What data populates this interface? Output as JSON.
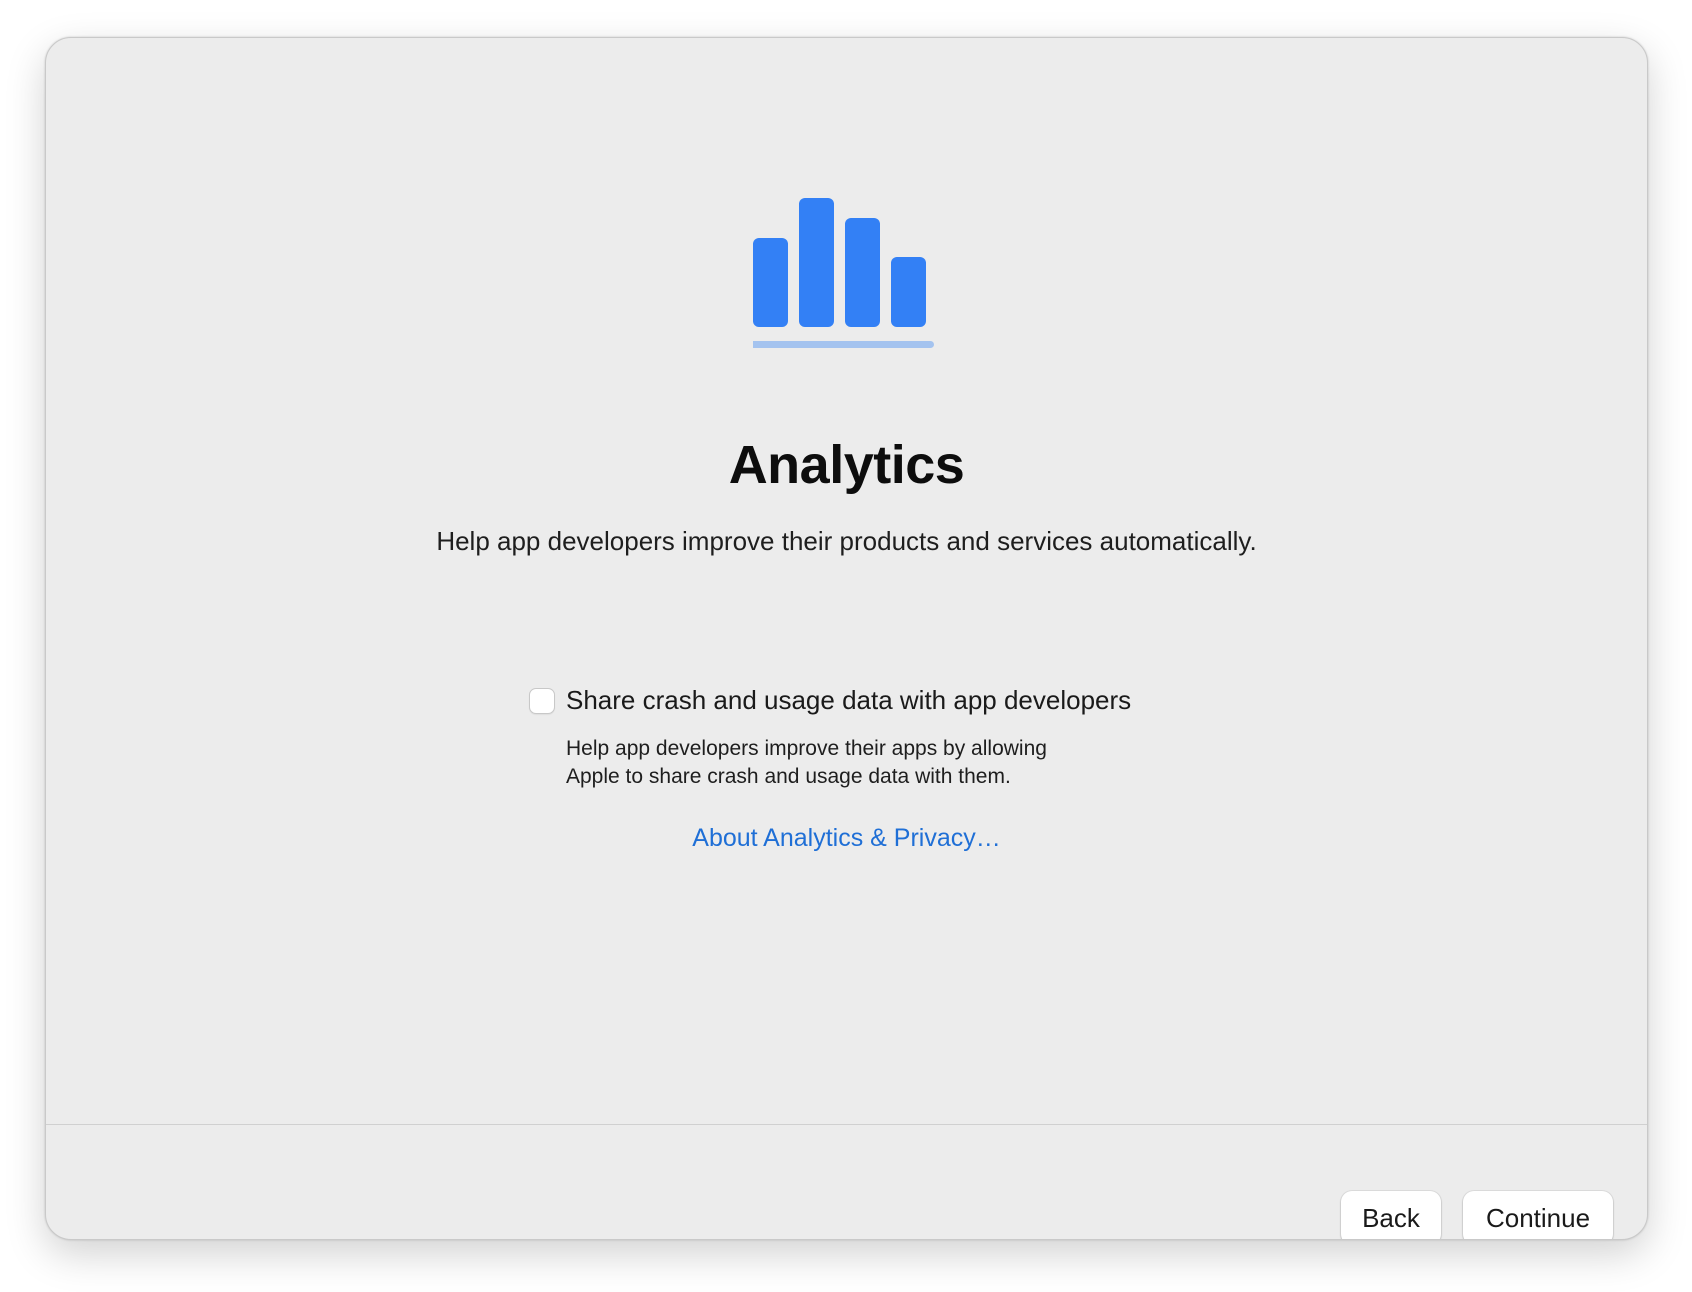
{
  "screen": {
    "title": "Analytics",
    "subtitle": "Help app developers improve their products and services automatically.",
    "hero_icon": "chart-bar-icon",
    "accent_color": "#3380f5",
    "link_color": "#1f6fd6"
  },
  "share_option": {
    "label": "Share crash and usage data with app developers",
    "checked": false,
    "description_line1": "Help app developers improve their apps by allowing",
    "description_line2": "Apple to share crash and usage data with them."
  },
  "links": {
    "about": "About Analytics & Privacy…"
  },
  "footer": {
    "back_label": "Back",
    "continue_label": "Continue"
  }
}
